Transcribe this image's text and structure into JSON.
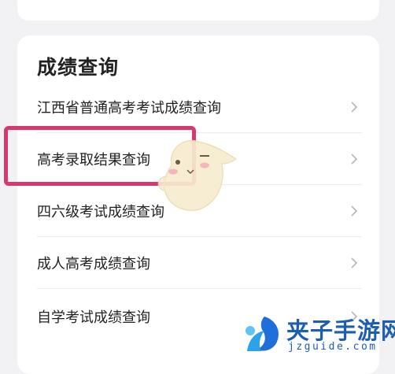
{
  "section": {
    "title": "成绩查询",
    "items": [
      {
        "label": "江西省普通高考考试成绩查询"
      },
      {
        "label": "高考录取结果查询"
      },
      {
        "label": "四六级考试成绩查询"
      },
      {
        "label": "成人高考成绩查询"
      },
      {
        "label": "自学考试成绩查询"
      }
    ]
  },
  "watermark": {
    "name": "夹子手游网",
    "url": "jzguide.com"
  },
  "colors": {
    "highlight": "#d9386e",
    "watermark": "#1e5eae",
    "background": "#f2f2f4"
  }
}
